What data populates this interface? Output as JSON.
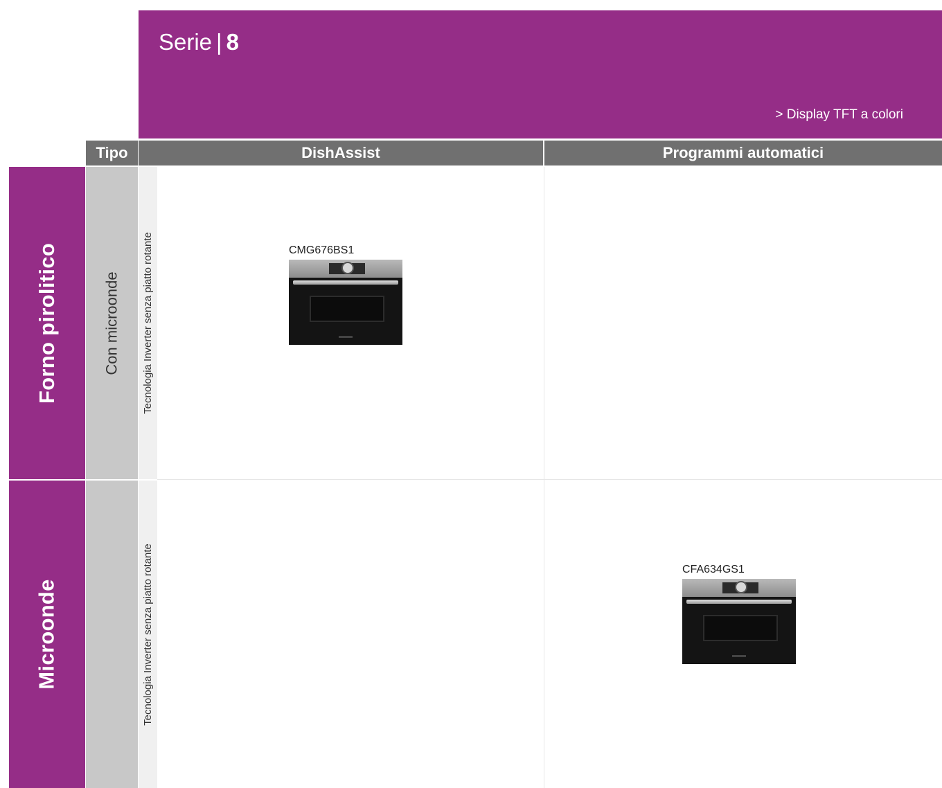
{
  "header": {
    "series_label": "Serie",
    "separator": "|",
    "series_number": "8",
    "feature": "> Display TFT a colori"
  },
  "columns": {
    "tipo": "Tipo",
    "col1": "DishAssist",
    "col2": "Programmi automatici"
  },
  "rows": [
    {
      "category": "Forno pirolitico",
      "subtype": "Con microonde",
      "technology": "Tecnologia Inverter senza piatto rotante",
      "product": {
        "code": "CMG676BS1",
        "column": "DishAssist"
      }
    },
    {
      "category": "Microonde",
      "subtype": "",
      "technology": "Tecnologia Inverter senza piatto rotante",
      "product": {
        "code": "CFA634GS1",
        "column": "Programmi automatici"
      }
    }
  ],
  "colors": {
    "brand_purple": "#952d87",
    "header_gray": "#707070",
    "subtype_gray": "#c8c8c8",
    "tech_light": "#f0f0f0"
  }
}
